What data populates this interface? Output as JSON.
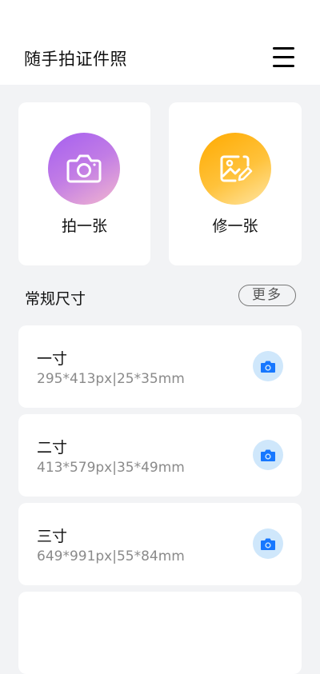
{
  "header": {
    "title": "随手拍证件照",
    "menu_icon": "hamburger-menu-icon"
  },
  "actions": [
    {
      "label": "拍一张",
      "icon": "camera-icon",
      "colors": [
        "#a55ff0",
        "#f2b6cf"
      ]
    },
    {
      "label": "修一张",
      "icon": "image-edit-icon",
      "colors": [
        "#ffaa00",
        "#ffe6a5"
      ]
    }
  ],
  "section": {
    "title": "常规尺寸",
    "more_label": "更多"
  },
  "sizes": [
    {
      "name": "一寸",
      "spec": "295*413px|25*35mm",
      "icon": "camera-icon"
    },
    {
      "name": "二寸",
      "spec": "413*579px|35*49mm",
      "icon": "camera-icon"
    },
    {
      "name": "三寸",
      "spec": "649*991px|55*84mm",
      "icon": "camera-icon"
    }
  ],
  "colors": {
    "background": "#f2f3f5",
    "camera_button_bg": "#cfe7fb",
    "camera_button_icon": "#1677ff"
  }
}
